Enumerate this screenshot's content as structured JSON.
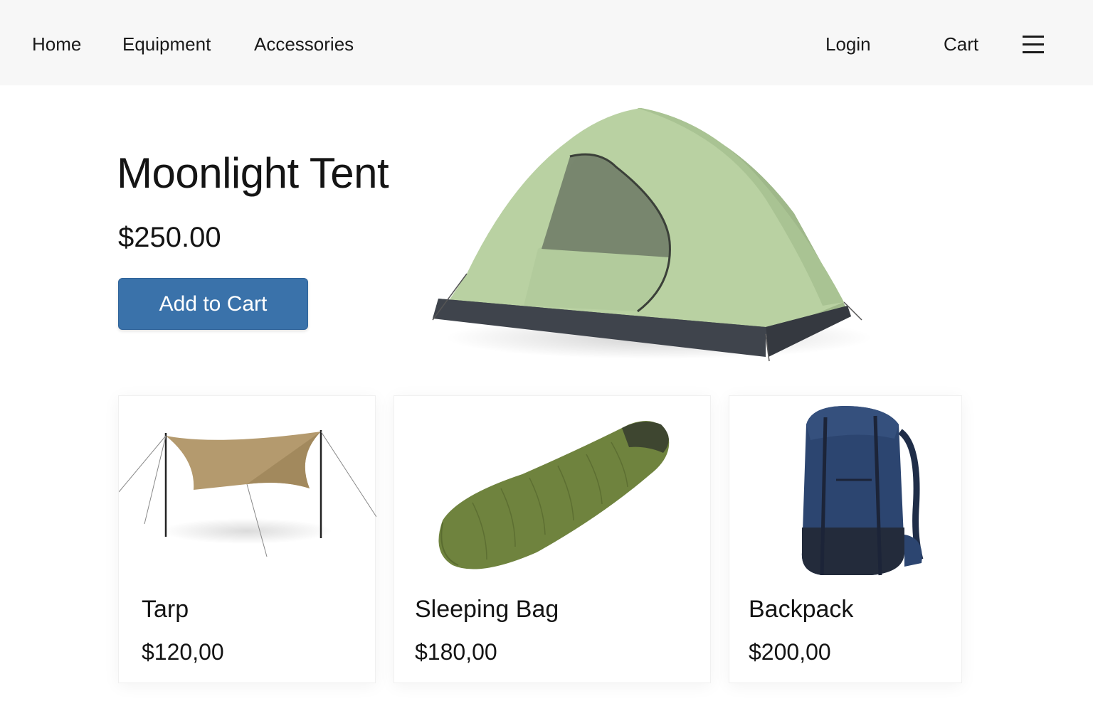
{
  "nav": {
    "links": [
      "Home",
      "Equipment",
      "Accessories"
    ],
    "login": "Login",
    "cart": "Cart",
    "menu_icon": "hamburger-menu-icon"
  },
  "hero": {
    "title": "Moonlight Tent",
    "price": "$250.00",
    "button": "Add to Cart",
    "image": "tent-image"
  },
  "products": [
    {
      "name": "Tarp",
      "price": "$120,00",
      "image": "tarp-image"
    },
    {
      "name": "Sleeping Bag",
      "price": "$180,00",
      "image": "sleeping-bag-image"
    },
    {
      "name": "Backpack",
      "price": "$200,00",
      "image": "backpack-image"
    }
  ],
  "colors": {
    "accent": "#3a72aa",
    "navbar_bg": "#f7f7f7",
    "tent_green": "#b7cf9f",
    "tarp_tan": "#b49a6e",
    "bag_green": "#6f833e",
    "pack_navy": "#2c4570"
  }
}
